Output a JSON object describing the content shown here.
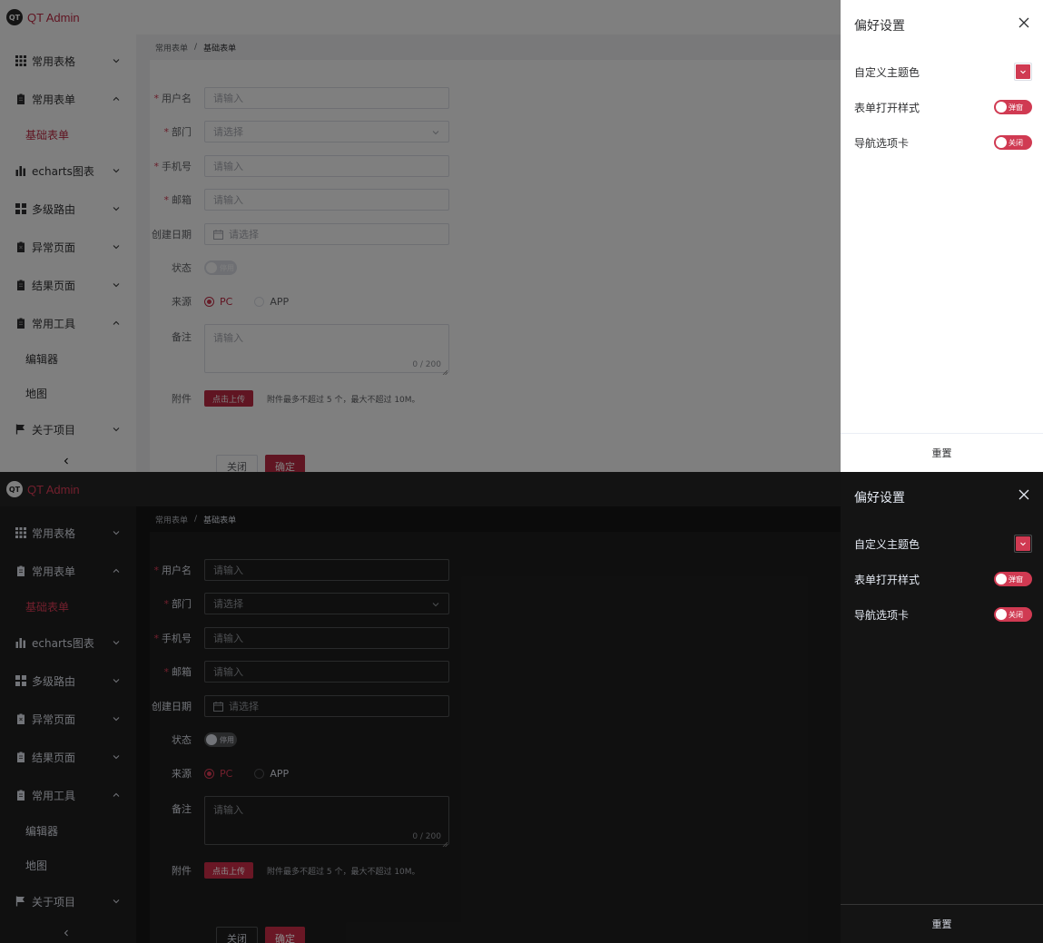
{
  "colors": {
    "primary": "#d03a52",
    "light_bg": "#ffffff",
    "dark_bg": "#141414"
  },
  "app": {
    "logo_text": "QT",
    "title": "QT Admin"
  },
  "nav": {
    "common_tables": "常用表格",
    "common_forms": "常用表单",
    "basic_form": "基础表单",
    "echarts": "echarts图表",
    "multi_route": "多级路由",
    "error_pages": "异常页面",
    "result_pages": "结果页面",
    "common_tools": "常用工具",
    "editor": "编辑器",
    "map": "地图",
    "about": "关于项目"
  },
  "breadcrumb": [
    "常用表单",
    "/",
    "基础表单"
  ],
  "form": {
    "username": {
      "label": "用户名",
      "placeholder": "请输入"
    },
    "department": {
      "label": "部门",
      "placeholder": "请选择"
    },
    "phone": {
      "label": "手机号",
      "placeholder": "请输入"
    },
    "email": {
      "label": "邮箱",
      "placeholder": "请输入"
    },
    "create_date": {
      "label": "创建日期",
      "placeholder": "请选择"
    },
    "status": {
      "label": "状态",
      "switch_text": "停用"
    },
    "source": {
      "label": "来源",
      "options": [
        "PC",
        "APP"
      ],
      "selected": "PC"
    },
    "remark": {
      "label": "备注",
      "placeholder": "请输入",
      "counter": "0 / 200"
    },
    "attachment": {
      "label": "附件",
      "button": "点击上传",
      "tip": "附件最多不超过 5 个，最大不超过 10M。"
    },
    "close_button": "关闭",
    "confirm_button": "确定",
    "required_mark": "*"
  },
  "drawer": {
    "title": "偏好设置",
    "theme_color_label": "自定义主题色",
    "form_style_label": "表单打开样式",
    "form_style_value": "弹窗",
    "nav_tabs_label": "导航选项卡",
    "nav_tabs_value": "关闭",
    "reset_button": "重置"
  },
  "icons": {
    "table": "grid-icon",
    "form": "clipboard-icon",
    "chart": "bar-chart-icon",
    "route": "apps-icon",
    "error": "clipboard-x-icon",
    "result": "clipboard-icon",
    "tools": "clipboard-icon",
    "about": "flag-icon"
  }
}
